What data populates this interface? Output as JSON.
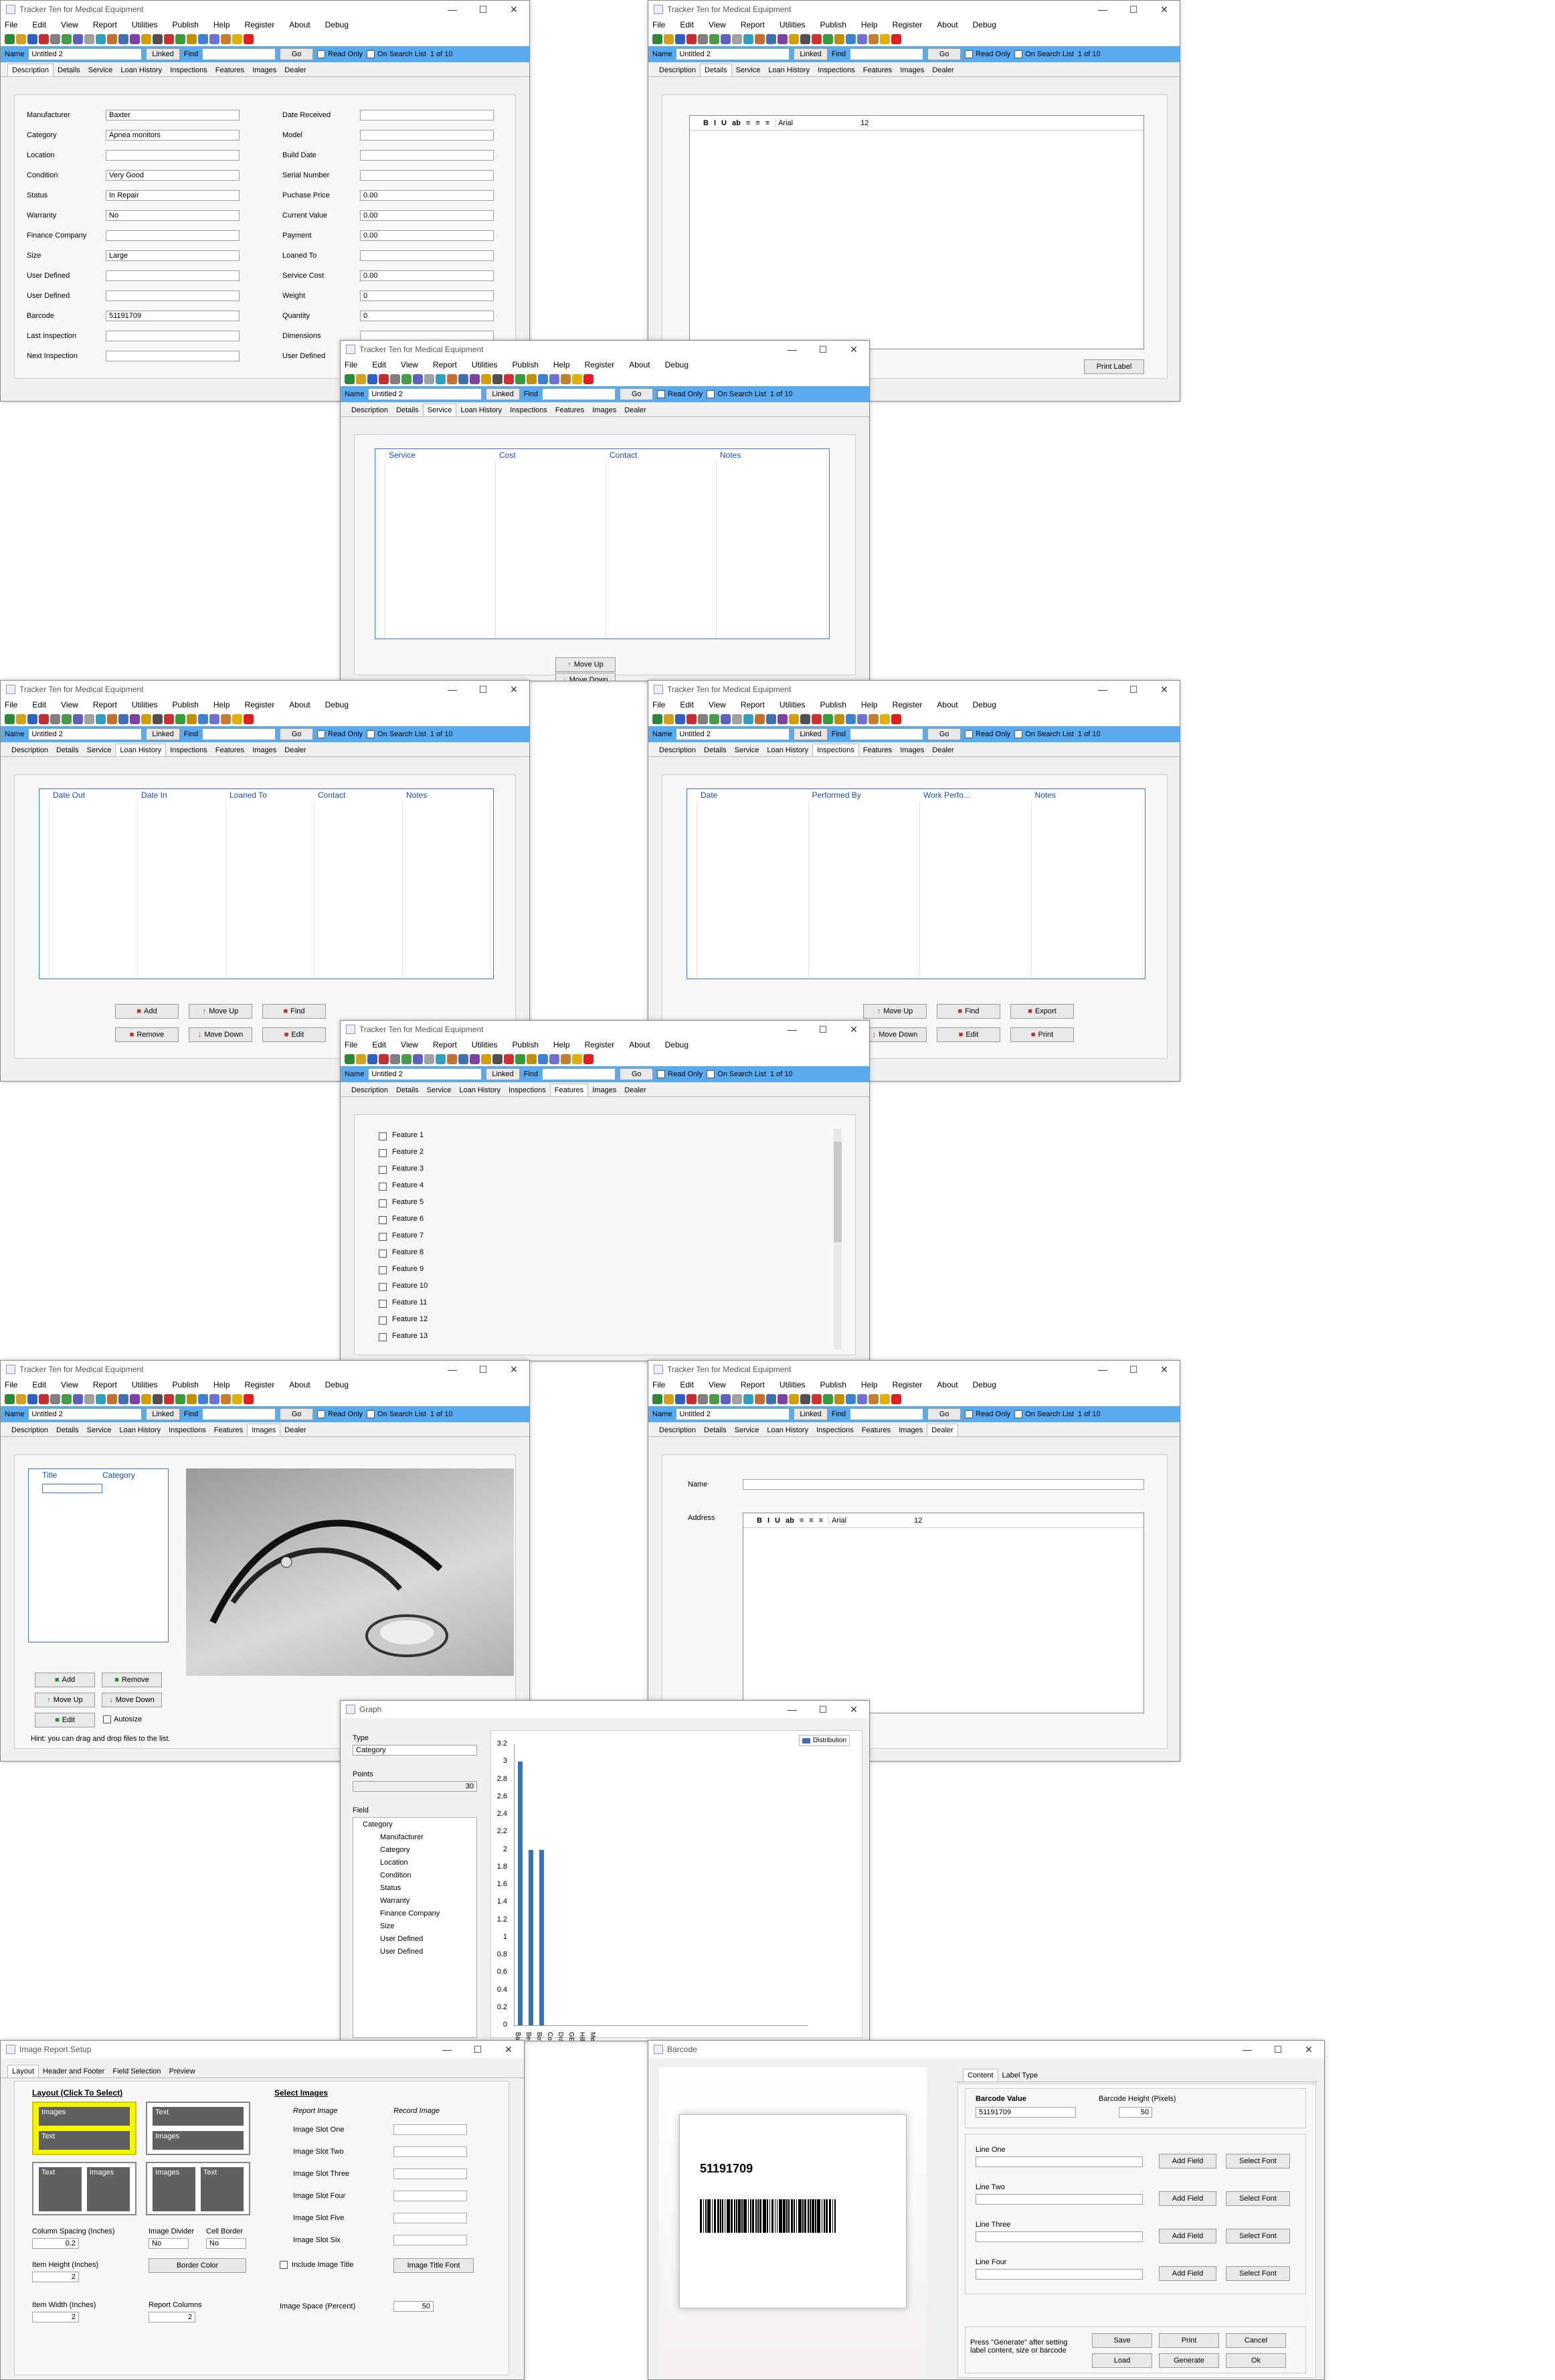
{
  "app_title": "Tracker Ten for Medical Equipment",
  "menu": [
    "File",
    "Edit",
    "View",
    "Report",
    "Utilities",
    "Publish",
    "Help",
    "Register",
    "About",
    "Debug"
  ],
  "namebar": {
    "name_label": "Name",
    "name_value": "Untitled 2",
    "linked": "Linked",
    "find": "Find",
    "go": "Go",
    "read_only": "Read Only",
    "on_search_list": "On Search List",
    "record_count": "1 of 10"
  },
  "tabs": [
    "Description",
    "Details",
    "Service",
    "Loan History",
    "Inspections",
    "Features",
    "Images",
    "Dealer"
  ],
  "description": {
    "left": [
      {
        "label": "Manufacturer",
        "value": "Baxter"
      },
      {
        "label": "Category",
        "value": "Apnea monitors"
      },
      {
        "label": "Location",
        "value": ""
      },
      {
        "label": "Condition",
        "value": "Very Good"
      },
      {
        "label": "Status",
        "value": "In Repair"
      },
      {
        "label": "Warranty",
        "value": "No"
      },
      {
        "label": "Finance Company",
        "value": ""
      },
      {
        "label": "Size",
        "value": "Large"
      },
      {
        "label": "User Defined",
        "value": ""
      },
      {
        "label": "User Defined",
        "value": ""
      },
      {
        "label": "Barcode",
        "value": "51191709"
      },
      {
        "label": "Last Inspection",
        "value": ""
      },
      {
        "label": "Next Inspection",
        "value": ""
      }
    ],
    "right": [
      {
        "label": "Date Received",
        "value": ""
      },
      {
        "label": "Model",
        "value": ""
      },
      {
        "label": "Build Date",
        "value": ""
      },
      {
        "label": "Serial Number",
        "value": ""
      },
      {
        "label": "Puchase Price",
        "value": "0.00"
      },
      {
        "label": "Current Value",
        "value": "0.00"
      },
      {
        "label": "Payment",
        "value": "0.00"
      },
      {
        "label": "Loaned To",
        "value": ""
      },
      {
        "label": "Service Cost",
        "value": "0.00"
      },
      {
        "label": "Weight",
        "value": "0"
      },
      {
        "label": "Quantity",
        "value": "0"
      },
      {
        "label": "Dimensions",
        "value": ""
      },
      {
        "label": "User Defined",
        "value": ""
      }
    ]
  },
  "details": {
    "font": "Arial",
    "size": "12",
    "print_label": "Print Label"
  },
  "service": {
    "columns": [
      "Service",
      "Cost",
      "Contact",
      "Notes"
    ],
    "move_up": "Move Up",
    "move_down": "Move Down"
  },
  "loan": {
    "columns": [
      "Date Out",
      "Date In",
      "Loaned To",
      "Contact",
      "Notes"
    ],
    "buttons": [
      "Add",
      "Move Up",
      "Find",
      "Remove",
      "Move Down",
      "Edit"
    ]
  },
  "inspections": {
    "columns": [
      "Date",
      "Performed By",
      "Work Perfo...",
      "Notes"
    ],
    "buttons": [
      "Move Up",
      "Find",
      "Export",
      "Move Down",
      "Edit",
      "Print"
    ]
  },
  "features": [
    "Feature 1",
    "Feature 2",
    "Feature 3",
    "Feature 4",
    "Feature 5",
    "Feature 6",
    "Feature 7",
    "Feature  8",
    "Feature  9",
    "Feature 10",
    "Feature 11",
    "Feature 12",
    "Feature 13"
  ],
  "images": {
    "columns": [
      "Title",
      "Category"
    ],
    "buttons": [
      "Add",
      "Remove",
      "Move Up",
      "Move Down",
      "Edit"
    ],
    "autosize": "Autosize",
    "hint": "Hint: you can drag and drop files to the list."
  },
  "dealer": {
    "name_label": "Name",
    "address_label": "Address",
    "font": "Arial",
    "size": "12"
  },
  "graph": {
    "title": "Graph",
    "type_label": "Type",
    "type_value": "Category",
    "points_label": "Points",
    "points_value": "30",
    "field_label": "Field",
    "fields": [
      "Category",
      "Manufacturer",
      "Category",
      "Location",
      "Condition",
      "Status",
      "Warranty",
      "Finance Company",
      "Size",
      "User Defined",
      "User Defined"
    ],
    "legend": "Distribution"
  },
  "chart_data": {
    "type": "bar",
    "categories": [
      "Baxter",
      "Beckman",
      "Bovie",
      "Cobra",
      "Dräger",
      "GE Healthcare",
      "Hill-Rom",
      "Medtronic"
    ],
    "values": [
      3,
      2,
      2,
      0,
      0,
      0,
      0,
      0
    ],
    "ylim": [
      0,
      3.2
    ],
    "yticks": [
      "0",
      "0.2",
      "0.4",
      "0.6",
      "0.8",
      "1",
      "1.2",
      "1.4",
      "1.6",
      "1.8",
      "2",
      "2.2",
      "2.4",
      "2.6",
      "2.8",
      "3",
      "3.2"
    ],
    "series": [
      {
        "name": "Distribution",
        "values": [
          3,
          2,
          2,
          0,
          0,
          0,
          0,
          0
        ]
      }
    ],
    "legend": "top-right"
  },
  "image_report": {
    "title": "Image Report Setup",
    "tabs": [
      "Layout",
      "Header and Footer",
      "Field Selection",
      "Preview"
    ],
    "layout_head": "Layout (Click To Select)",
    "select_head": "Select Images",
    "report_image": "Report Image",
    "record_image": "Record Image",
    "slots": [
      "Image Slot One",
      "Image Slot Two",
      "Image Slot Three",
      "Image Slot Four",
      "Image Slot Five",
      "Image Slot Six"
    ],
    "include_title": "Include Image Title",
    "title_font": "Image Title Font",
    "image_space": "Image Space (Percent)",
    "image_space_value": "50",
    "col_spacing": "Column Spacing (Inches)",
    "col_spacing_value": "0.2",
    "image_divider": "Image Divider",
    "divider_value": "No",
    "cell_border": "Cell Border",
    "cell_border_value": "No",
    "border_color": "Border Color",
    "item_height": "Item Height (Inches)",
    "item_height_value": "2",
    "item_width": "Item Width (Inches)",
    "item_width_value": "2",
    "report_columns": "Report Columns",
    "report_columns_value": "2",
    "thumb_labels": {
      "images": "Images",
      "text": "Text"
    }
  },
  "barcode": {
    "title": "Barcode",
    "tabs": [
      "Content",
      "Label Type"
    ],
    "value_label": "Barcode Value",
    "value": "51191709",
    "height_label": "Barcode Height (Pixels)",
    "height_value": "50",
    "lines": [
      "Line One",
      "Line Two",
      "Line Three",
      "Line Four"
    ],
    "add_field": "Add Field",
    "select_font": "Select Font",
    "hint": "Press \"Generate\" after setting label content, size or barcode",
    "buttons": [
      "Save",
      "Print",
      "Cancel",
      "Load",
      "Generate",
      "Ok"
    ]
  }
}
